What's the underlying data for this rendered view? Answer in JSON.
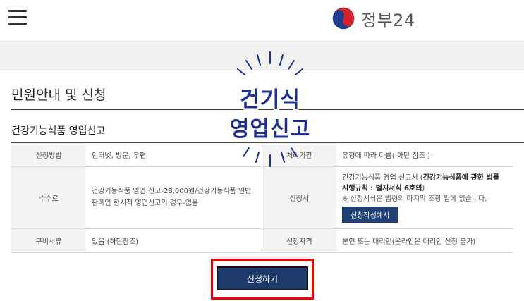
{
  "header": {
    "brand_text": "정부24",
    "logo_icon": "taegeuk-logo-icon",
    "menu_icon": "hamburger-menu-icon"
  },
  "page": {
    "title": "민원안내 및 신청",
    "section_title": "건강기능식품 영업신고"
  },
  "overlay": {
    "line1": "건기식",
    "line2": "영업신고",
    "color": "#1f2f8f"
  },
  "table": {
    "row1": {
      "label_a": "신청방법",
      "value_a": "인터넷, 방문, 우편",
      "label_b": "처리기간",
      "value_b": "유형에 따라 다름( 하단 참조 )"
    },
    "row2": {
      "label_a": "수수료",
      "value_a": "건강기능식품 영업 신고-28,000원/건강기능식품 일반판매업 한시적 영업신고의 경우-없음",
      "label_b": "신청서",
      "form_prefix": "건강기능식품 영업 신고서 (",
      "form_bold": "건강기능식품에 관한 법률 시행규칙 : 별지서식 6호의",
      "form_suffix": ")",
      "note": "※ 신청서식은 법령의 마지막 조항 밑에 있습니다.",
      "example_button": "신청작성예시"
    },
    "row3": {
      "label_a": "구비서류",
      "value_a": "있음 (하단참조)",
      "label_b": "신청자격",
      "value_b": "본인 또는 대리인(온라인은 대리인 신청 불가)"
    }
  },
  "actions": {
    "apply_button": "신청하기",
    "highlight_color": "#f00000",
    "button_color": "#1d3a6b"
  }
}
